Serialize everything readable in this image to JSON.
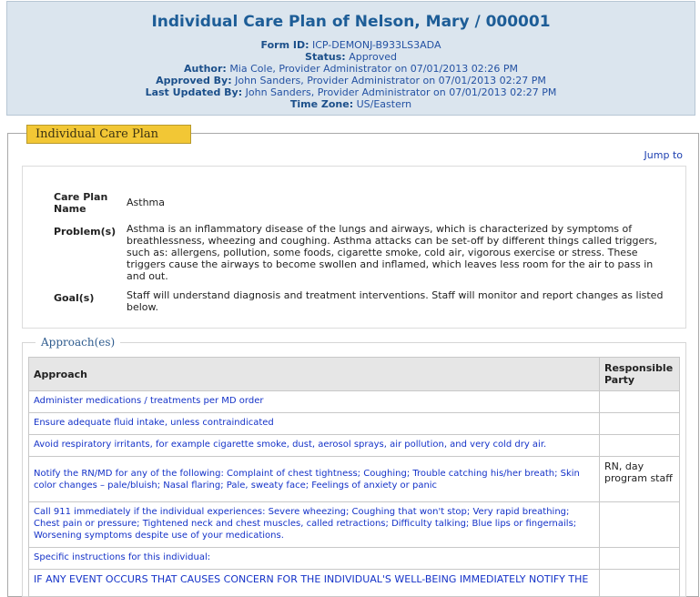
{
  "header": {
    "title": "Individual Care Plan of Nelson, Mary / 000001",
    "fields": [
      {
        "label": "Form ID:",
        "value": "ICP-DEMONJ-B933LS3ADA"
      },
      {
        "label": "Status:",
        "value": "Approved"
      },
      {
        "label": "Author:",
        "value": "Mia Cole, Provider Administrator  on 07/01/2013 02:26 PM"
      },
      {
        "label": "Approved By:",
        "value": "John Sanders, Provider Administrator  on 07/01/2013 02:27 PM"
      },
      {
        "label": "Last Updated By:",
        "value": "John Sanders, Provider Administrator on 07/01/2013 02:27 PM"
      },
      {
        "label": "Time Zone:",
        "value": " US/Eastern"
      }
    ]
  },
  "section": {
    "tab_label": "Individual Care Plan",
    "jump_label": "Jump to"
  },
  "info": {
    "care_plan_name_label": "Care Plan Name",
    "care_plan_name": "Asthma",
    "problems_label": "Problem(s)",
    "problems": "Asthma is an inflammatory disease of the lungs and airways, which is characterized by symptoms of breathlessness, wheezing and coughing.  Asthma attacks can be set-off by different things called triggers, such as: allergens, pollution, some foods, cigarette smoke, cold air, vigorous exercise or stress. These triggers cause the airways to become swollen and inflamed, which leaves less room for the air to pass in and out.",
    "goals_label": "Goal(s)",
    "goals": "Staff will understand diagnosis and treatment interventions. Staff will monitor and report changes as listed below."
  },
  "approaches": {
    "legend": "Approach(es)",
    "col_approach": "Approach",
    "col_responsible": "Responsible Party",
    "rows": [
      {
        "approach": "Administer medications / treatments per MD order",
        "responsible": ""
      },
      {
        "approach": "Ensure adequate fluid intake, unless contraindicated",
        "responsible": ""
      },
      {
        "approach": "Avoid respiratory irritants, for example cigarette smoke, dust, aerosol sprays, air pollution, and very cold dry air.",
        "responsible": ""
      },
      {
        "approach": "Notify the RN/MD for any of the following: Complaint of chest tightness; Coughing; Trouble catching his/her breath; Skin color changes – pale/bluish; Nasal flaring; Pale, sweaty face; Feelings of anxiety or panic",
        "responsible": "RN, day program staff"
      },
      {
        "approach": "Call 911 immediately if the individual experiences: Severe wheezing; Coughing that won't stop; Very rapid breathing; Chest pain or pressure; Tightened neck and chest muscles, called retractions; Difficulty talking; Blue lips or fingernails; Worsening symptoms despite use of your medications.",
        "responsible": ""
      },
      {
        "approach": "Specific instructions for this individual:",
        "responsible": ""
      },
      {
        "approach": "IF ANY EVENT OCCURS THAT CAUSES CONCERN FOR THE INDIVIDUAL'S WELL-BEING IMMEDIATELY NOTIFY THE",
        "responsible": ""
      }
    ]
  }
}
